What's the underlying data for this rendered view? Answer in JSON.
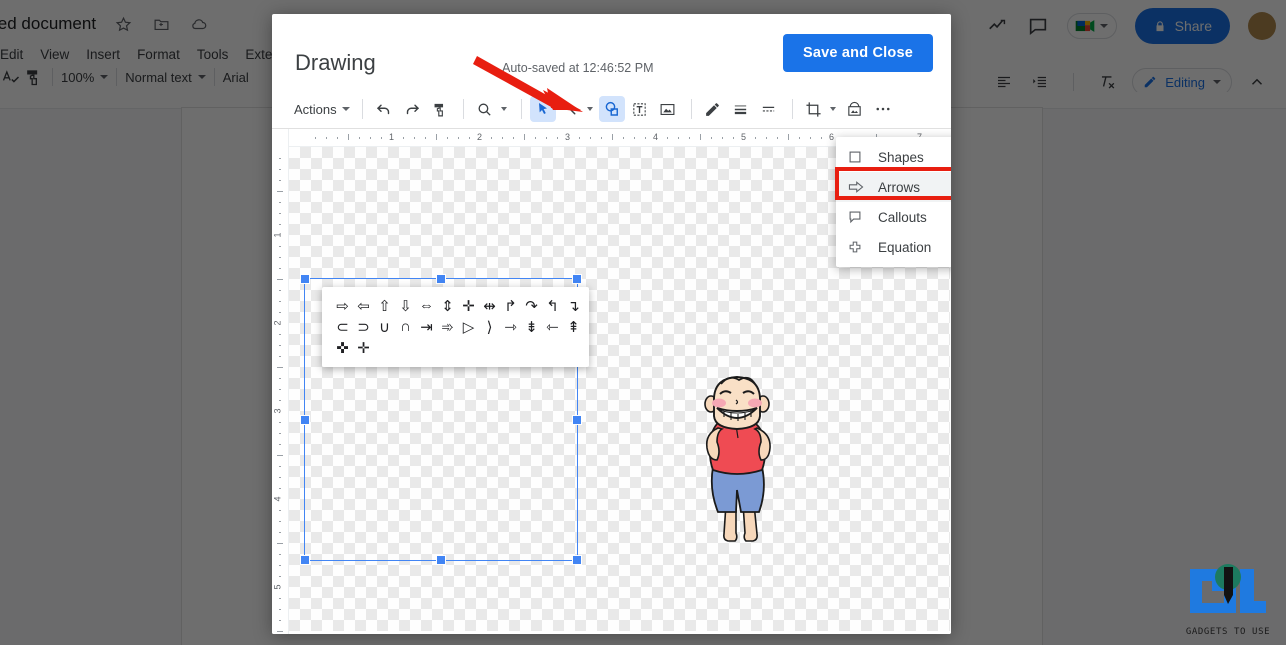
{
  "docs": {
    "title": "led document",
    "title_icons": [
      "star-icon",
      "move-to-folder-icon",
      "cloud-saved-icon"
    ],
    "menu": [
      "Edit",
      "View",
      "Insert",
      "Format",
      "Tools",
      "Extens"
    ],
    "toolbar": {
      "spellcheck": "spellcheck-icon",
      "paint_format": "paint-format-icon",
      "zoom": "100%",
      "style": "Normal text",
      "font": "Arial"
    },
    "right": {
      "activity_icon": "activity-trend-icon",
      "comment_icon": "comment-icon",
      "meet_icon": "google-meet-icon",
      "share_label": "Share",
      "lock_icon": "lock-icon"
    },
    "right2": {
      "align_icon": "align-left-icon",
      "indent_icon": "indent-icon",
      "clear_format_icon": "clear-formatting-icon",
      "mode_label": "Editing",
      "pencil_icon": "pencil-icon",
      "collapse_icon": "chevron-up-icon"
    }
  },
  "modal": {
    "title": "Drawing",
    "autosave": "Auto-saved at 12:46:52 PM",
    "save_label": "Save and Close",
    "toolbar": {
      "actions_label": "Actions",
      "items": [
        {
          "name": "undo-icon",
          "selected": false
        },
        {
          "name": "redo-icon",
          "selected": false
        },
        {
          "name": "paint-format-icon",
          "selected": false
        },
        {
          "name": "zoom-icon",
          "selected": false
        },
        {
          "name": "select-arrow-icon",
          "selected": true
        },
        {
          "name": "line-icon",
          "selected": false
        },
        {
          "name": "shape-icon",
          "selected": true
        },
        {
          "name": "text-box-icon",
          "selected": false
        },
        {
          "name": "image-icon",
          "selected": false
        },
        {
          "name": "line-color-pencil-icon",
          "selected": false
        },
        {
          "name": "line-weight-icon",
          "selected": false
        },
        {
          "name": "line-dash-icon",
          "selected": false
        },
        {
          "name": "crop-icon",
          "selected": false
        },
        {
          "name": "mask-image-icon",
          "selected": false
        },
        {
          "name": "more-options-icon",
          "selected": false
        }
      ]
    },
    "ruler": {
      "horizontal": [
        "1",
        "2",
        "3",
        "4",
        "5",
        "6",
        "7"
      ],
      "vertical": [
        "1",
        "2",
        "3",
        "4",
        "5"
      ]
    },
    "menu": {
      "items": [
        {
          "label": "Shapes",
          "icon": "square-shape-icon",
          "highlighted": false
        },
        {
          "label": "Arrows",
          "icon": "arrow-right-icon",
          "highlighted": true
        },
        {
          "label": "Callouts",
          "icon": "callout-icon",
          "highlighted": false
        },
        {
          "label": "Equation",
          "icon": "plus-equation-icon",
          "highlighted": false
        }
      ],
      "highlight_color": "#e81e10"
    },
    "palette": {
      "name": "arrows-shape-palette",
      "rows": [
        [
          "arrow-right",
          "arrow-left",
          "arrow-up",
          "arrow-down",
          "arrow-left-right",
          "arrow-up-down",
          "arrow-quad",
          "arrow-bent-quad",
          "arrow-bent",
          "arrow-u-turn",
          "arrow-left-up",
          "arrow-bent-up"
        ],
        [
          "arrow-curved-left",
          "arrow-curved-right",
          "arrow-curved-up",
          "arrow-curved-down",
          "arrow-striped-right",
          "arrow-notched-right",
          "arrow-pentagon",
          "arrow-chevron",
          "arrow-right-callout",
          "arrow-down-callout",
          "arrow-left-callout",
          "arrow-up-callout"
        ],
        [
          "arrow-quad-callout",
          "arrow-quad-callout-2"
        ]
      ]
    },
    "canvas": {
      "image_name": "cartoon-boy-image",
      "selected": true
    }
  },
  "annotation": {
    "arrow_color": "#e81e10",
    "target": "shape-tool-button"
  },
  "watermark": {
    "text": "GADGETS TO USE",
    "logo": "gadgets-to-use-logo"
  }
}
